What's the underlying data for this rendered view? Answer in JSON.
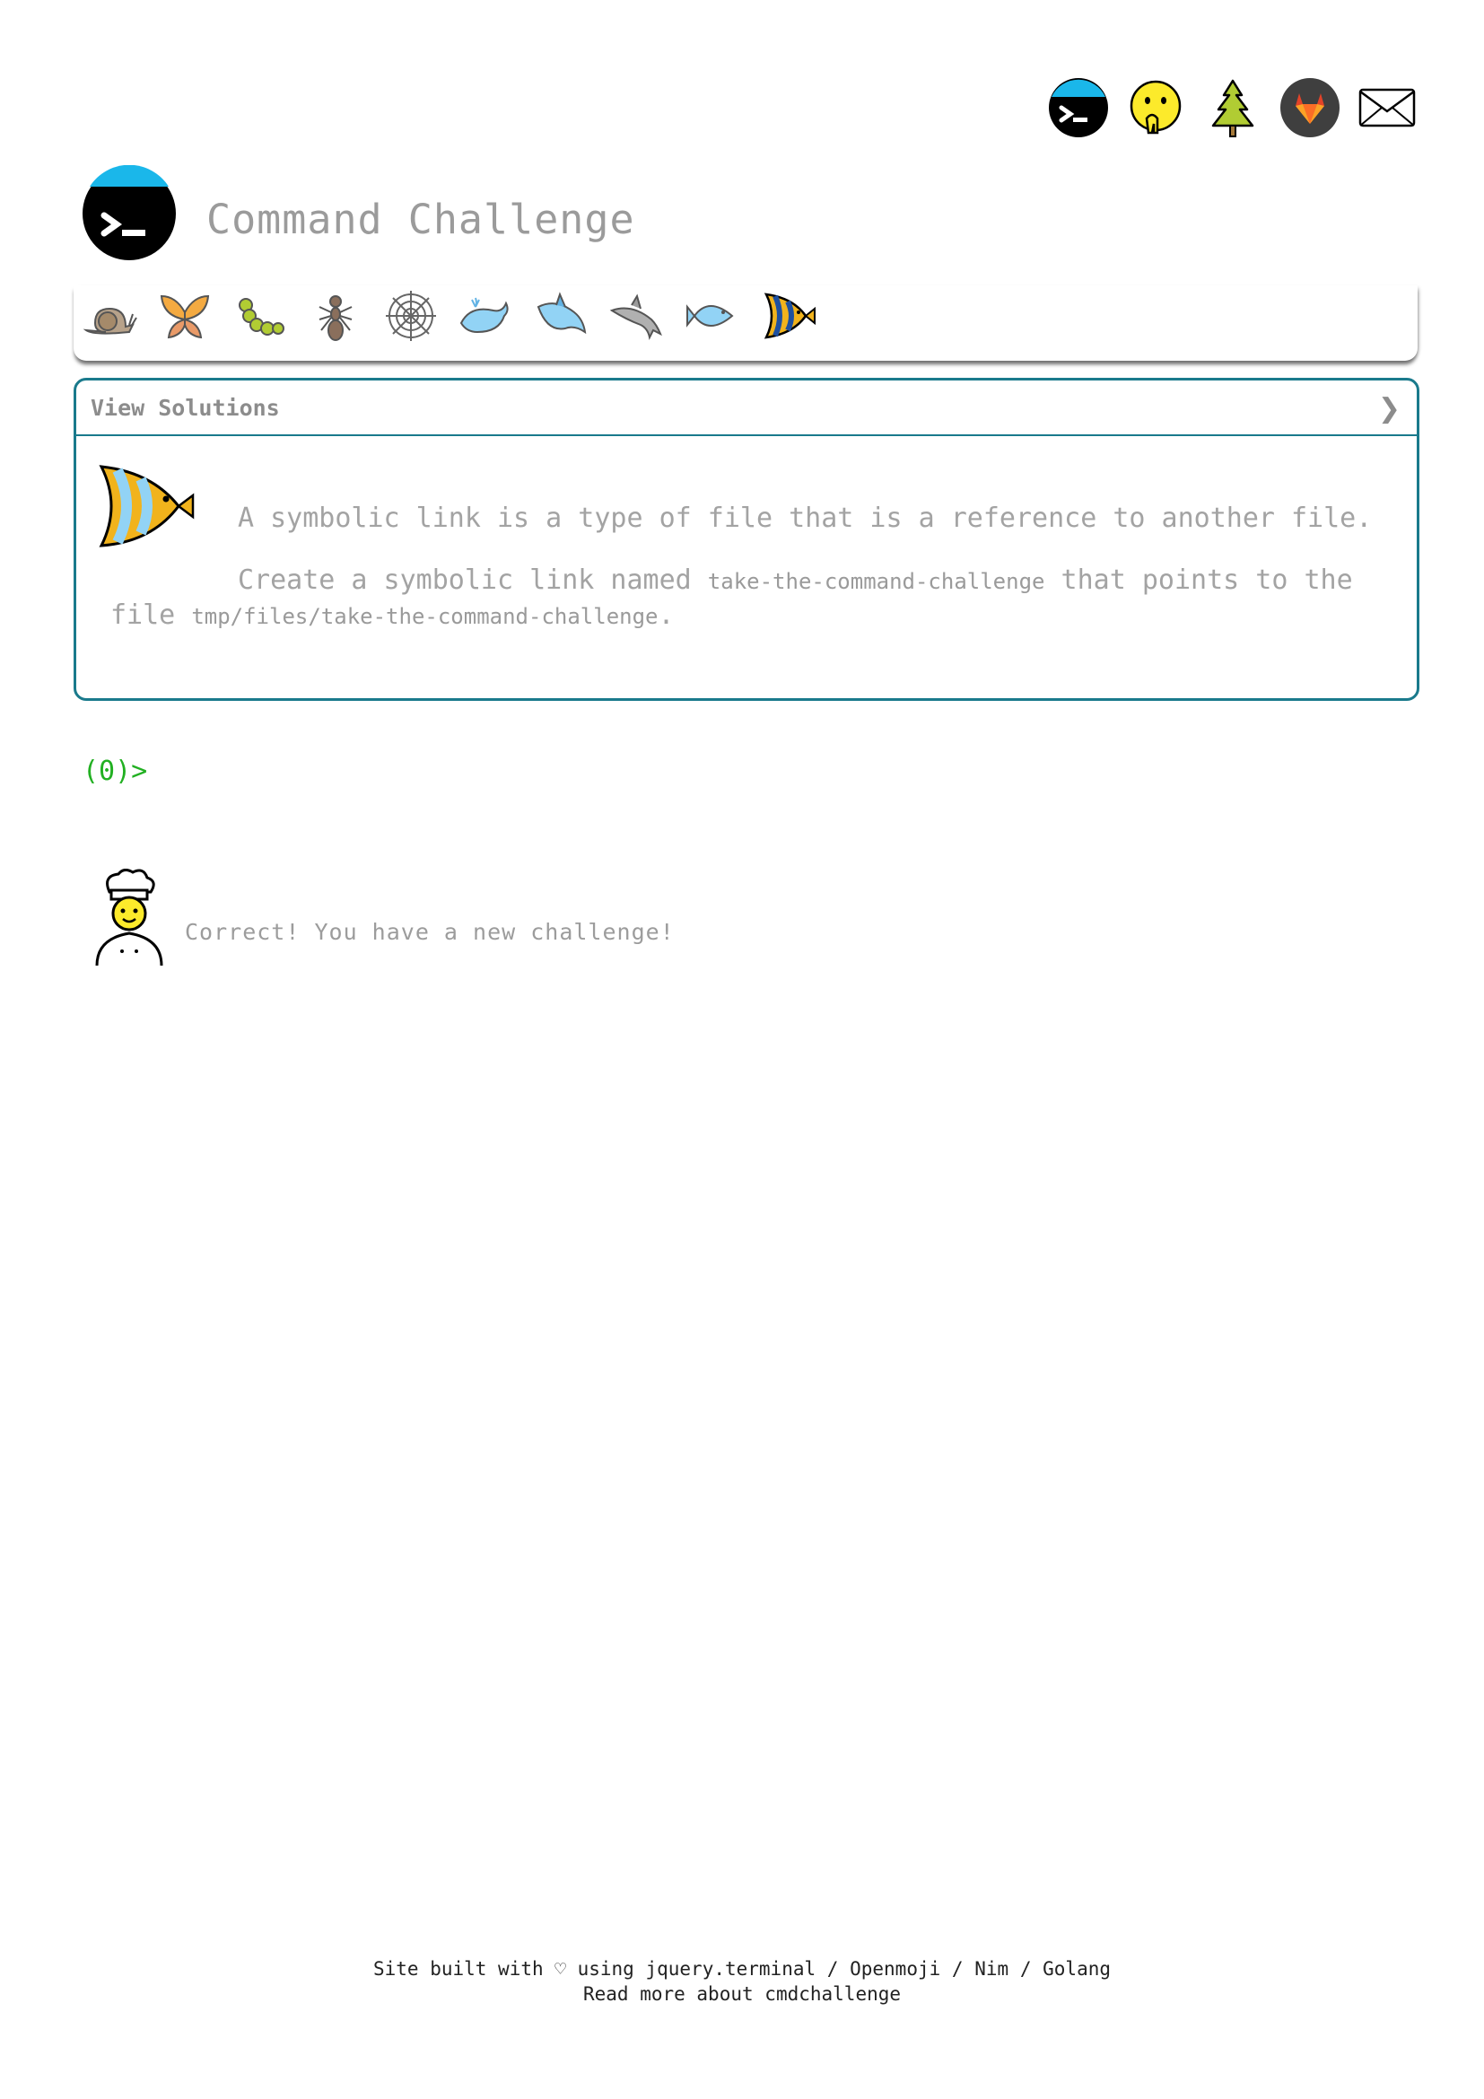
{
  "app": {
    "title": "Command Challenge"
  },
  "top_nav": {
    "icons": [
      {
        "name": "terminal-icon",
        "label": "terminal"
      },
      {
        "name": "hand-over-mouth-icon",
        "label": "face with hand over mouth"
      },
      {
        "name": "tree-icon",
        "label": "evergreen tree"
      },
      {
        "name": "gitlab-icon",
        "label": "gitlab"
      },
      {
        "name": "mail-icon",
        "label": "envelope"
      }
    ]
  },
  "levels": {
    "icons": [
      "snail-icon",
      "butterfly-icon",
      "caterpillar-icon",
      "ant-icon",
      "spider-web-icon",
      "whale-icon",
      "shark-icon",
      "dolphin-icon",
      "fish-icon",
      "tropical-fish-icon"
    ],
    "current_index": 9
  },
  "challenge": {
    "view_solutions_label": "View Solutions",
    "chevron": "❯",
    "description_line1": "A symbolic link is a type of file that is a reference to another file.",
    "description_line2_prefix": "Create a symbolic link named ",
    "link_name": "take-the-command-challenge",
    "description_line2_middle": " that points to the file ",
    "target_path": "tmp/files/take-the-command-challenge",
    "description_line2_suffix": "."
  },
  "terminal": {
    "prompt": "(0)>"
  },
  "message": {
    "text": "Correct! You have a new challenge!"
  },
  "footer": {
    "line1_prefix": "Site built with",
    "heart": "♡",
    "line1_using": "using",
    "link_jquery": "jquery.terminal",
    "sep": "/",
    "link_openmoji": "Openmoji",
    "link_nim": "Nim",
    "link_golang": "Golang",
    "line2_prefix": "Read more about",
    "link_cmdchallenge": "cmdchallenge"
  },
  "colors": {
    "panel_border": "#1a7a8c",
    "prompt_green": "#22b022",
    "terminal_blue": "#1ab7ea"
  }
}
